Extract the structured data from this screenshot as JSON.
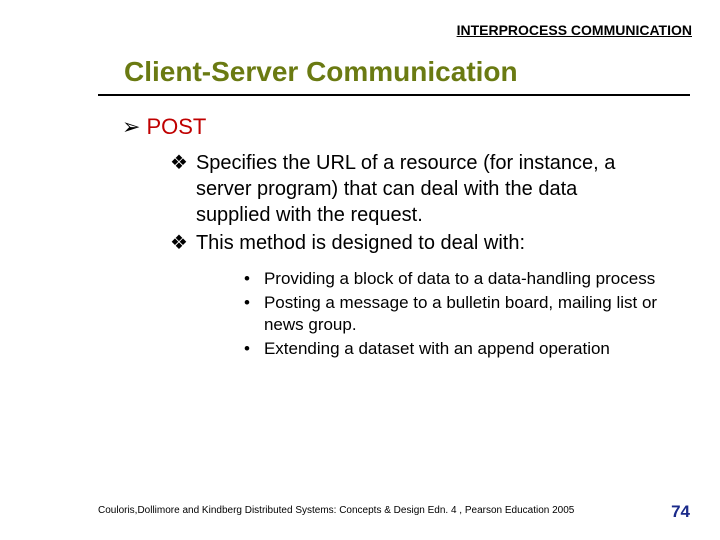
{
  "header": {
    "chapter": "INTERPROCESS COMMUNICATION"
  },
  "title": "Client-Server Communication",
  "bullets": {
    "l1": {
      "glyph": "➢",
      "text": "POST"
    },
    "l2": [
      {
        "glyph": "❖",
        "text": "Specifies the URL of a resource (for instance, a server program) that can deal with the data supplied with the request."
      },
      {
        "glyph": "❖",
        "text": "This method is designed to deal with:"
      }
    ],
    "l3": [
      {
        "glyph": "•",
        "text": "Providing a block of data to a data-handling process"
      },
      {
        "glyph": "•",
        "text": "Posting a message to a bulletin board, mailing list or news group."
      },
      {
        "glyph": "•",
        "text": "Extending a dataset with an append operation"
      }
    ]
  },
  "footer": {
    "citation": "Couloris,Dollimore and Kindberg  Distributed Systems: Concepts & Design  Edn. 4 , Pearson Education 2005",
    "page": "74"
  }
}
